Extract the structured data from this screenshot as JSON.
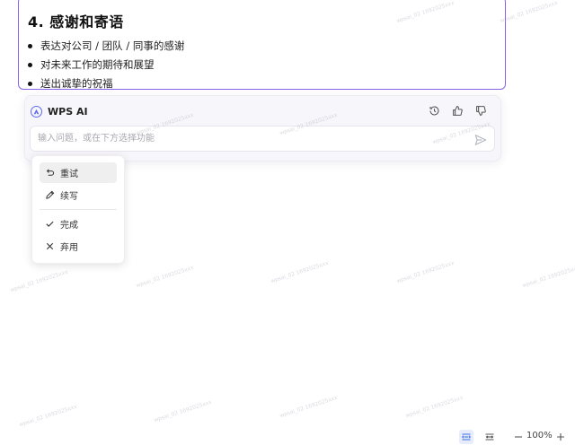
{
  "document": {
    "heading": "4. 感谢和寄语",
    "bullets": [
      "表达对公司 / 团队 / 同事的感谢",
      "对未来工作的期待和展望",
      "送出诚挚的祝福"
    ]
  },
  "ai_panel": {
    "title": "WPS AI",
    "input_placeholder": "输入问题，或在下方选择功能",
    "actions": {
      "history_icon": "history-icon",
      "like_icon": "thumbs-up-icon",
      "dislike_icon": "thumbs-down-icon"
    }
  },
  "menu": {
    "items": [
      {
        "label": "重试",
        "icon": "undo-icon"
      },
      {
        "label": "续写",
        "icon": "pencil-icon"
      },
      {
        "label": "完成",
        "icon": "check-icon"
      },
      {
        "label": "弃用",
        "icon": "close-icon"
      }
    ]
  },
  "status_bar": {
    "zoom": "100%"
  },
  "watermark": "wpsai_02 1692025xxx",
  "colors": {
    "accent": "#8a63e8",
    "logo": "#5b6cf0"
  }
}
